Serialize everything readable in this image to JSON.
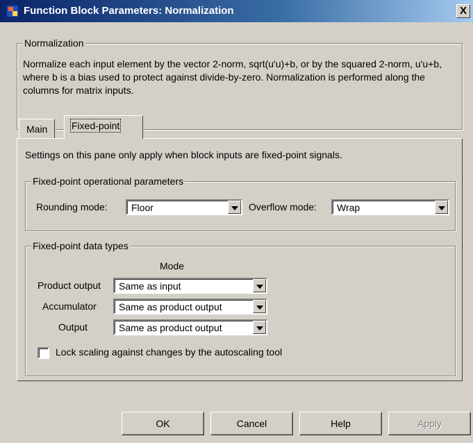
{
  "window": {
    "title": "Function Block Parameters: Normalization",
    "close_glyph": "X"
  },
  "description": {
    "group_title": "Normalization",
    "text": "Normalize each input element by the vector 2-norm, sqrt(u'u)+b, or by the squared 2-norm, u'u+b, where b is a bias used to protect against divide-by-zero.  Normalization is performed along the columns for matrix inputs."
  },
  "tabs": [
    {
      "label": "Main",
      "active": false
    },
    {
      "label": "Fixed-point",
      "active": true
    }
  ],
  "pane": {
    "info": "Settings on this pane only apply when block inputs are fixed-point signals.",
    "operational": {
      "title": "Fixed-point operational parameters",
      "rounding_label": "Rounding mode:",
      "rounding_value": "Floor",
      "overflow_label": "Overflow mode:",
      "overflow_value": "Wrap"
    },
    "data_types": {
      "title": "Fixed-point data types",
      "mode_header": "Mode",
      "rows": [
        {
          "label": "Product output",
          "value": "Same as input"
        },
        {
          "label": "Accumulator",
          "value": "Same as product output"
        },
        {
          "label": "Output",
          "value": "Same as product output"
        }
      ],
      "lock_label": "Lock scaling against changes by the autoscaling tool",
      "lock_checked": false
    }
  },
  "buttons": {
    "ok": "OK",
    "cancel": "Cancel",
    "help": "Help",
    "apply": "Apply"
  }
}
